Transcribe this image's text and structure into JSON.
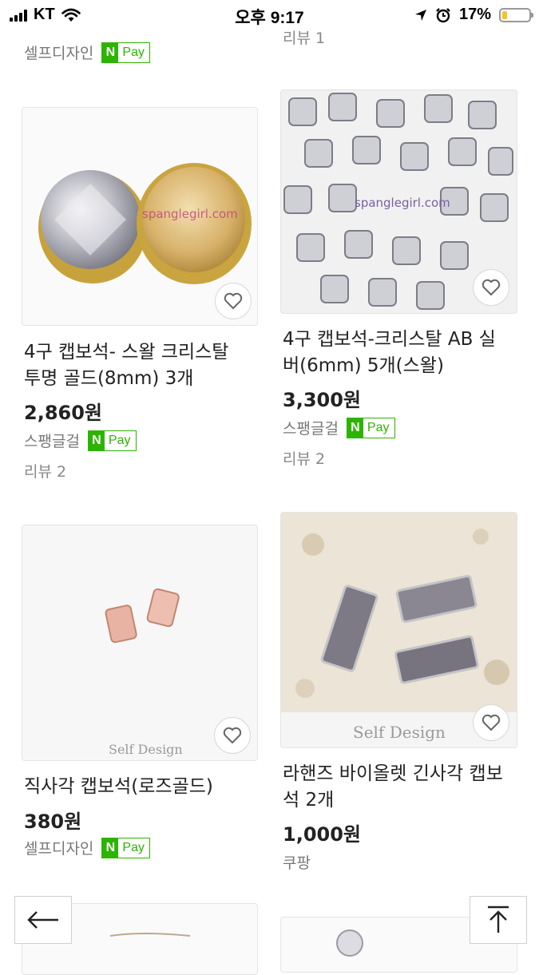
{
  "status_bar": {
    "carrier": "KT",
    "time": "오후 9:17",
    "battery": "17%",
    "battery_level": 0.17
  },
  "top_partial": {
    "left_seller": "셀프디자인",
    "left_pay": "Pay",
    "right_review": "리뷰 1"
  },
  "products": [
    {
      "title_line1": "4구 캡보석- 스왈 크리스탈",
      "title_line2": "투명 골드(8mm) 3개",
      "price": "2,860원",
      "seller": "스팽글걸",
      "pay": "Pay",
      "review": "리뷰 2",
      "watermark": "spanglegirl.com"
    },
    {
      "title_line1": "4구 캡보석-크리스탈 AB 실",
      "title_line2": "버(6mm) 5개(스왈)",
      "price": "3,300원",
      "seller": "스팽글걸",
      "pay": "Pay",
      "review": "리뷰 2",
      "watermark": "spanglegirl.com"
    },
    {
      "title_line1": "직사각 캡보석(로즈골드)",
      "price": "380원",
      "seller": "셀프디자인",
      "pay": "Pay",
      "watermark": "Self Design"
    },
    {
      "title_line1": "라핸즈 바이올렛 긴사각 캡보",
      "title_line2": "석 2개",
      "price": "1,000원",
      "seller": "쿠팡",
      "watermark": "Self Design"
    }
  ],
  "icons": {
    "back": "arrow-left-icon",
    "top": "arrow-up-to-top-icon",
    "wish": "heart-icon"
  }
}
